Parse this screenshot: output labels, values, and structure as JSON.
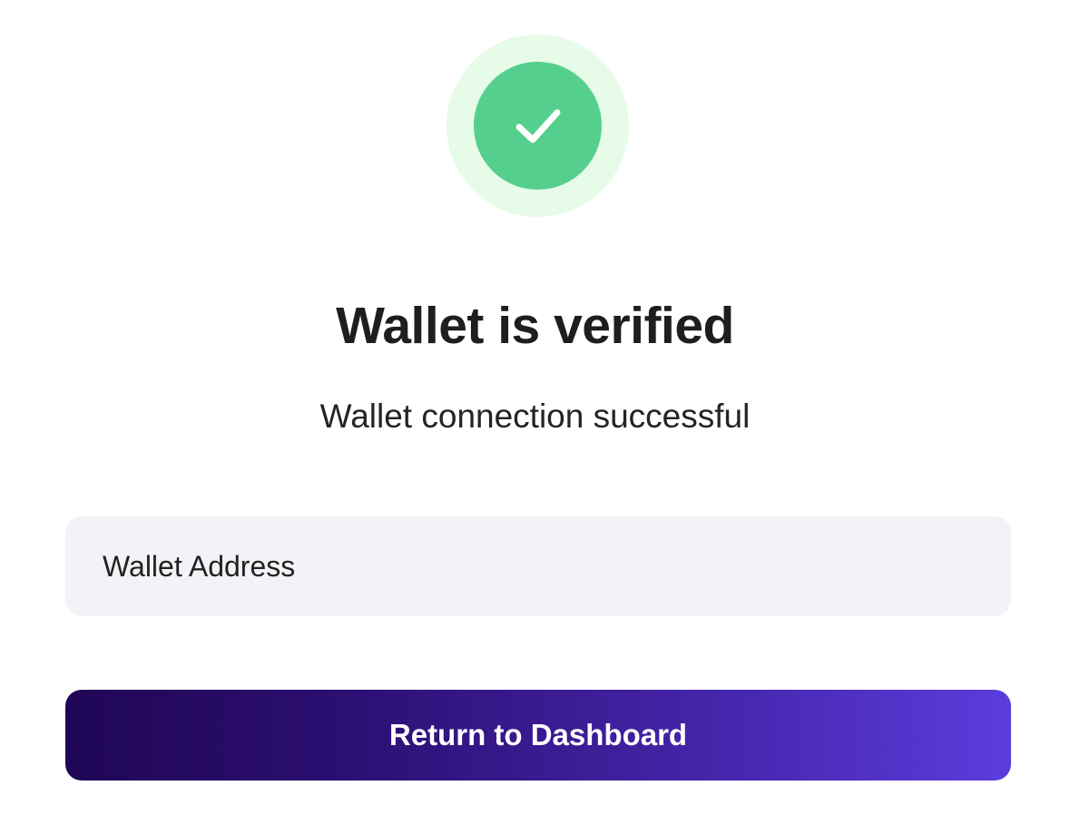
{
  "status": {
    "icon": "checkmark-icon",
    "colors": {
      "halo": "#e6fbe8",
      "circle": "#55cf8d",
      "check": "#ffffff"
    }
  },
  "title": "Wallet is verified",
  "subtitle": "Wallet connection successful",
  "address_field": {
    "label": "Wallet Address",
    "background": "#f2f3f7"
  },
  "button": {
    "label": "Return to Dashboard",
    "gradient_start": "#200654",
    "gradient_end": "#5b3ddc"
  }
}
